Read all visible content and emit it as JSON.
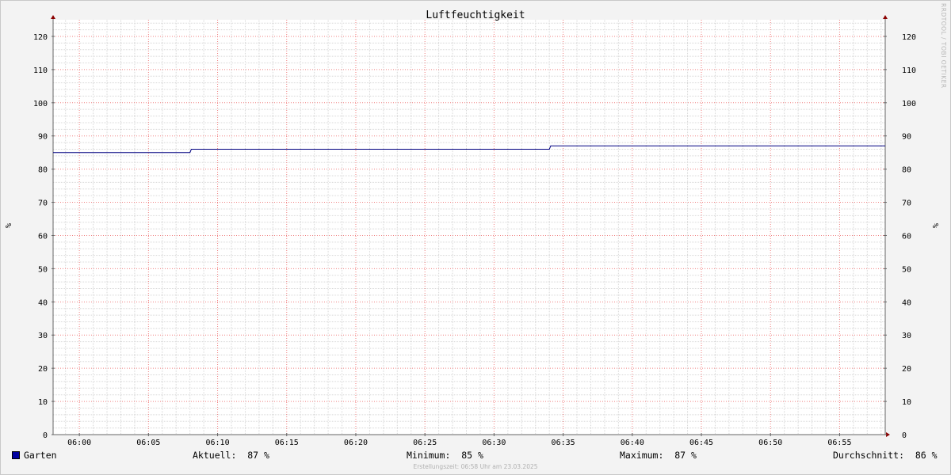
{
  "watermark": "RRDTOOL / TOBI OETIKER",
  "footer": "Erstellungszeit: 06:58 Uhr am 23.03.2025",
  "unit_left": "%",
  "unit_right": "%",
  "legend": {
    "series_name": "Garten",
    "aktuell": "Aktuell:  87 %",
    "minimum": "Minimum:  85 %",
    "maximum": "Maximum:  87 %",
    "durchschnitt": "Durchschnitt:  86 %"
  },
  "colors": {
    "line": "#000080",
    "swatch": "#0000a0",
    "major_grid": "#f08080",
    "minor_grid": "#d8d8d8"
  },
  "chart_data": {
    "type": "line",
    "title": "Luftfeuchtigkeit",
    "ylim": [
      0,
      125
    ],
    "yticks": [
      0,
      10,
      20,
      30,
      40,
      50,
      60,
      70,
      80,
      90,
      100,
      110,
      120
    ],
    "x_tick_labels": [
      "06:00",
      "06:05",
      "06:10",
      "06:15",
      "06:20",
      "06:25",
      "06:30",
      "06:35",
      "06:40",
      "06:45",
      "06:50",
      "06:55"
    ],
    "x_range_minutes": [
      -1.9,
      58.3
    ],
    "grid": true,
    "series": [
      {
        "name": "Garten",
        "color": "#000080",
        "points": [
          {
            "t": -1.9,
            "v": 85
          },
          {
            "t": 8.0,
            "v": 85
          },
          {
            "t": 8.1,
            "v": 86
          },
          {
            "t": 34.0,
            "v": 86
          },
          {
            "t": 34.1,
            "v": 87
          },
          {
            "t": 58.3,
            "v": 87
          }
        ]
      }
    ]
  }
}
